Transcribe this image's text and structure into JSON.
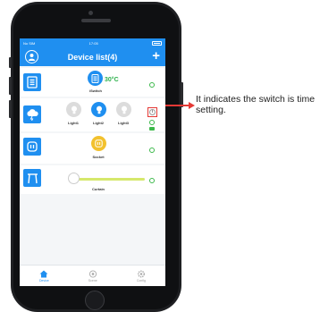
{
  "status_bar": {
    "carrier": "No SIM",
    "time": "17:05"
  },
  "header": {
    "title": "Device list(4)",
    "add_symbol": "+"
  },
  "devices": {
    "iswitch": {
      "label": "iSwitch",
      "temperature": "30°C"
    },
    "lights": [
      {
        "label": "Light1"
      },
      {
        "label": "Light2"
      },
      {
        "label": "Light3"
      }
    ],
    "socket": {
      "label": "Socket"
    },
    "curtain": {
      "label": "Curtain"
    }
  },
  "tabs": [
    {
      "label": "Device"
    },
    {
      "label": "Scene"
    },
    {
      "label": "Config"
    }
  ],
  "annotation": {
    "text": "It indicates the switch is time setting."
  },
  "colors": {
    "primary": "#1f8ff0",
    "toggle_on": "#3cb84a",
    "socket": "#f2c12e",
    "highlight": "#e53935",
    "slider": "#d6e86c"
  },
  "icons": {
    "avatar": "user-icon",
    "iswitch": "switch-panel-icon",
    "group": "cloud-lightning-icon",
    "socket": "power-icon",
    "curtain": "curtain-icon",
    "timer": "clock-icon",
    "tab_device": "home-icon",
    "tab_scene": "scene-icon",
    "tab_config": "gear-icon"
  }
}
